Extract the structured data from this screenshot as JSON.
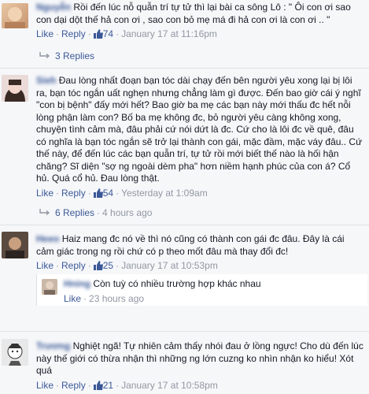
{
  "comments": [
    {
      "name": "Nguyễn",
      "text": "Rồi đến lúc nỗ quẫn trí tự tử thì lại bài ca sông Lô : \" Ôi con ơi sao con dại dột thế hả con ơi , sao con bỏ mẹ má đi hả con ơi là con ơi .. \"",
      "like_label": "Like",
      "reply_label": "Reply",
      "likes": "74",
      "time": "January 17 at 11:16pm",
      "replies_label": "3 Replies"
    },
    {
      "name": "Sieh",
      "text": "Đau lòng nhất đoạn bạn tóc dài chạy đến bên người yêu xong lại bị lôi ra, bạn tóc ngắn uất nghẹn nhưng chẳng làm gì được. Đến bao giờ cái ý nghĩ \"con bị bệnh\" đấy mới hết? Bao giờ ba mẹ các bạn này mới thấu đc hết nỗi lòng phận làm con? Bố ba mẹ không đc, bỏ người yêu càng không xong, chuyện tình cảm mà, đâu phải cứ nói dứt là đc. Cứ cho là lôi đc về quê, đâu có nghĩa là bạn tóc ngắn sẽ trở lại thành con gái, mặc đầm, mặc váy đâu.. Cứ thế này, để đến lúc các bạn quẫn trí, tự tử rồi mới biết thế nào là hối hận chăng? Sĩ diện \"sợ ng ngoài dèm pha\" hơn niềm hạnh phúc của con á? Cổ hủ. Quá cổ hủ. Đau lòng thật.",
      "like_label": "Like",
      "reply_label": "Reply",
      "likes": "54",
      "time": "Yesterday at 1:09am",
      "replies_label": "6 Replies",
      "replies_time": "4 hours ago"
    },
    {
      "name": "Heeo",
      "text": "Haiz mang đc nó về thì nó cũng có thành con gái đc đâu. Đây là cái cảm giác trong ng rồi chứ có p theo mốt đâu mà thay đổi đc!",
      "like_label": "Like",
      "reply_label": "Reply",
      "likes": "25",
      "time": "January 17 at 10:53pm"
    },
    {
      "name": "Hning",
      "text": "Còn tuỳ có nhiều trường hợp khác nhau",
      "like_label": "Like",
      "time": "23 hours ago"
    },
    {
      "name": "Trương",
      "text": "Nghiệt ngã! Tự nhiên cảm thấy nhói đau ở lồng ngực! Cho dù đến lúc này thế giới có thừa nhận thì những ng lớn cuzng ko nhìn nhận ko hiểu! Xót quá",
      "like_label": "Like",
      "reply_label": "Reply",
      "likes": "21",
      "time": "January 17 at 10:58pm"
    }
  ]
}
